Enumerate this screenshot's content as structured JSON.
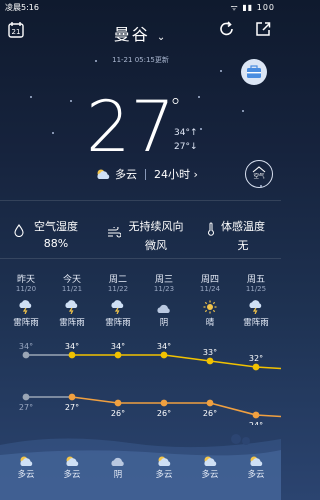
{
  "status_bar": {
    "carrier_time": "凌晨5:16",
    "indicators": "ᯤ ▮▮ 100"
  },
  "header": {
    "city": "曼谷",
    "updated": "11-21 05:15更新",
    "calendar_day": "21"
  },
  "current": {
    "temperature": "27",
    "degree": "°",
    "high": "34°↑",
    "low": "27°↓",
    "condition": "多云",
    "hours_button": "24小时 ›",
    "badge": "空气"
  },
  "details": [
    {
      "label": "空气湿度",
      "value": "88%"
    },
    {
      "label": "无持续风向",
      "value": "微风"
    },
    {
      "label": "体感温度",
      "value": "无"
    }
  ],
  "forecast": {
    "days": [
      {
        "day": "昨天",
        "date": "11/20",
        "weather": "雷阵雨",
        "icon": "thunderstorm-icon",
        "high": "34°",
        "low": "27°"
      },
      {
        "day": "今天",
        "date": "11/21",
        "weather": "雷阵雨",
        "icon": "thunderstorm-icon",
        "high": "34°",
        "low": "27°"
      },
      {
        "day": "周二",
        "date": "11/22",
        "weather": "雷阵雨",
        "icon": "thunderstorm-icon",
        "high": "34°",
        "low": "26°"
      },
      {
        "day": "周三",
        "date": "11/23",
        "weather": "阴",
        "icon": "overcast-icon",
        "high": "34°",
        "low": "26°"
      },
      {
        "day": "周四",
        "date": "11/24",
        "weather": "晴",
        "icon": "sunny-icon",
        "high": "33°",
        "low": "26°"
      },
      {
        "day": "周五",
        "date": "11/25",
        "weather": "雷阵雨",
        "icon": "thunderstorm-icon",
        "high": "32°",
        "low": "24°"
      }
    ],
    "night": [
      "多云",
      "多云",
      "阴",
      "多云",
      "多云",
      "多云"
    ]
  },
  "chart_data": {
    "type": "line",
    "categories": [
      "11/20",
      "11/21",
      "11/22",
      "11/23",
      "11/24",
      "11/25"
    ],
    "series": [
      {
        "values": [
          34,
          34,
          34,
          34,
          33,
          32
        ]
      },
      {
        "values": [
          27,
          27,
          26,
          26,
          26,
          24
        ]
      }
    ],
    "colors": {
      "high": "#f2c200",
      "low": "#f0a040",
      "past": "#9aa5b5"
    }
  }
}
